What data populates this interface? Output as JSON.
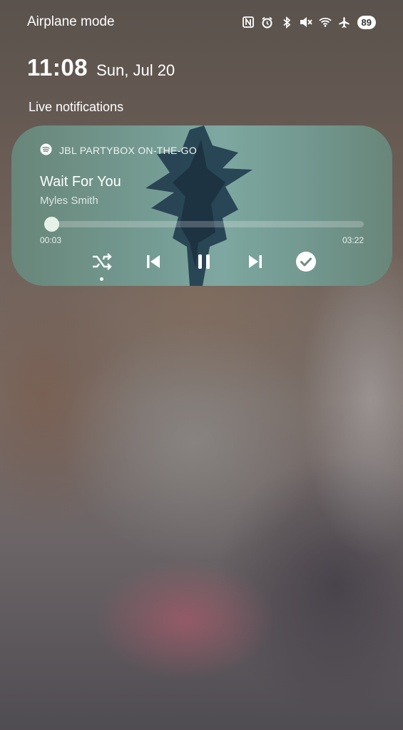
{
  "status_bar": {
    "mode_label": "Airplane mode",
    "icons": [
      "nfc-icon",
      "alarm-icon",
      "bluetooth-icon",
      "mute-icon",
      "wifi-icon",
      "airplane-icon"
    ],
    "battery": "89"
  },
  "lockscreen": {
    "time": "11:08",
    "date": "Sun, Jul 20"
  },
  "section_title": "Live notifications",
  "media": {
    "app_icon": "spotify-icon",
    "device": "JBL PARTYBOX ON-THE-GO",
    "title": "Wait For You",
    "artist": "Myles Smith",
    "elapsed": "00:03",
    "duration": "03:22",
    "progress": 0.015,
    "controls": [
      "shuffle-icon",
      "previous-icon",
      "pause-icon",
      "next-icon",
      "check-icon"
    ]
  }
}
